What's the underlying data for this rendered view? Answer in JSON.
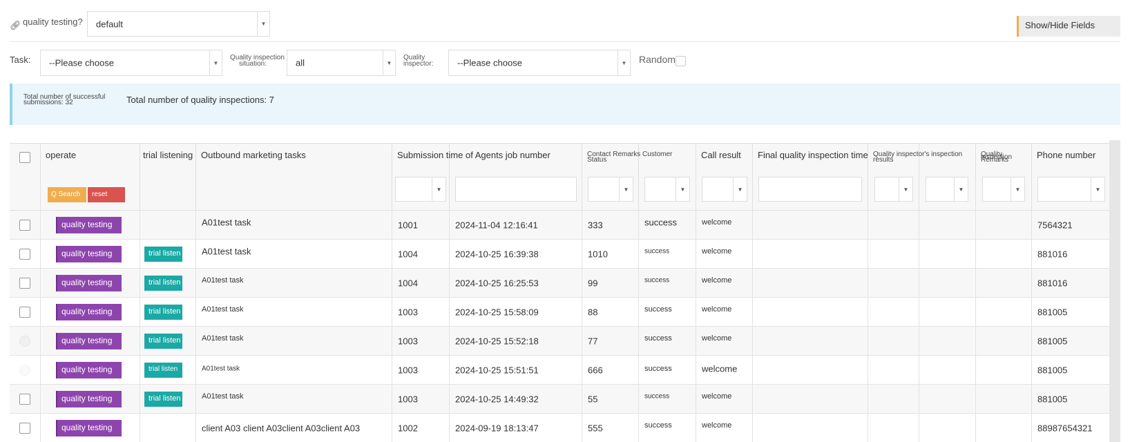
{
  "top": {
    "quality_testing_label": "quality testing?",
    "quality_testing_value": "default",
    "show_hide": "Show/Hide Fields"
  },
  "filters": {
    "task_label": "Task:",
    "task_value": "--Please choose",
    "situation_label_1": "Quality inspection",
    "situation_label_2": "situation:",
    "situation_value": "all",
    "inspector_label_1": "Quality",
    "inspector_label_2": "inspector:",
    "inspector_value": "--Please choose",
    "random_label": "Random:"
  },
  "info": {
    "successful_1": "Total number of successful",
    "successful_2": "submissions: 32",
    "total_inspections": "Total number of quality inspections: 7"
  },
  "table": {
    "headers": {
      "operate": "operate",
      "trial": "trial listening",
      "outbound": "Outbound marketing tasks",
      "submission": "Submission time of Agents job number",
      "contact_1": "Contact Remarks Customer",
      "contact_2": "Status",
      "call_result": "Call result",
      "final_time": "Final quality inspection time",
      "qi_results_1": "Quality inspector's inspection",
      "qi_results_2": "results",
      "qi_remarks_1": "Quality",
      "qi_remarks_2": "inspection",
      "qi_remarks_3": "Remarks",
      "phone": "Phone number"
    },
    "search_btn": "Q Search",
    "reset_btn": "reset",
    "qt_badge": "quality testing",
    "tl_badge": "trial listen",
    "rows": [
      {
        "task": "A01test task",
        "agent": "1001",
        "time": "2024-11-04 12:16:41",
        "remarks": "333",
        "status": "success",
        "result": "welcome",
        "phone": "7564321"
      },
      {
        "task": "A01test task",
        "agent": "1004",
        "time": "2024-10-25 16:39:38",
        "remarks": "1010",
        "status": "success",
        "result": "welcome",
        "phone": "881016"
      },
      {
        "task": "A01test task",
        "agent": "1004",
        "time": "2024-10-25 16:25:53",
        "remarks": "99",
        "status": "success",
        "result": "welcome",
        "phone": "881016"
      },
      {
        "task": "A01test task",
        "agent": "1003",
        "time": "2024-10-25 15:58:09",
        "remarks": "88",
        "status": "success",
        "result": "welcome",
        "phone": "881005"
      },
      {
        "task": "A01test task",
        "agent": "1003",
        "time": "2024-10-25 15:52:18",
        "remarks": "77",
        "status": "success",
        "result": "welcome",
        "phone": "881005"
      },
      {
        "task": "A01test task",
        "agent": "1003",
        "time": "2024-10-25 15:51:51",
        "remarks": "666",
        "status": "success",
        "result": "welcome",
        "phone": "881005"
      },
      {
        "task": "A01test task",
        "agent": "1003",
        "time": "2024-10-25 14:49:32",
        "remarks": "55",
        "status": "success",
        "result": "welcome",
        "phone": "881005"
      },
      {
        "task": "client A03 client A03client A03client A03",
        "agent": "1002",
        "time": "2024-09-19 18:13:47",
        "remarks": "555",
        "status": "success",
        "result": "welcome",
        "phone": "88987654321"
      }
    ]
  },
  "colors": {
    "qt_badge": "#8e44ad",
    "tl_badge": "#1aa9a5",
    "search_btn": "#f0ad4e",
    "reset_btn": "#d9534f",
    "info_bg": "#eaf5fc"
  }
}
